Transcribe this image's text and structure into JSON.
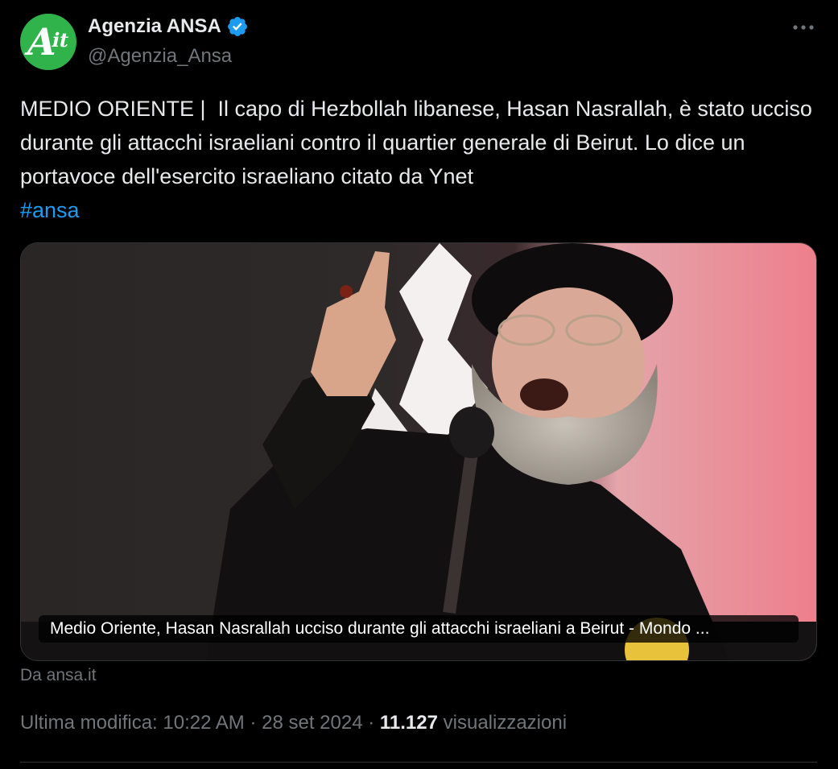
{
  "author": {
    "display_name": "Agenzia ANSA",
    "handle": "@Agenzia_Ansa",
    "avatar_mark": "A",
    "avatar_sub": "it",
    "verified": true
  },
  "icons": {
    "verified": "verified-badge-icon",
    "more": "more-options-icon"
  },
  "colors": {
    "background": "#000000",
    "text": "#e7e9ea",
    "secondary": "#71767b",
    "link": "#1d9bf0",
    "avatar": "#2fb34a"
  },
  "tweet": {
    "text": "MEDIO ORIENTE |  Il capo di Hezbollah libanese, Hasan Nasrallah, è stato ucciso durante gli attacchi israeliani contro il quartier generale di Beirut. Lo dice un portavoce dell'esercito israeliano citato da Ynet",
    "hashtag": "#ansa"
  },
  "card": {
    "caption": "Medio Oriente, Hasan Nasrallah ucciso durante gli attacchi israeliani a Beirut - Mondo ...",
    "source": "Da ansa.it"
  },
  "meta": {
    "prefix": "Ultima modifica: 10:22 AM · 28 set 2024 · ",
    "views_count": "11.127",
    "views_label": " visualizzazioni"
  }
}
